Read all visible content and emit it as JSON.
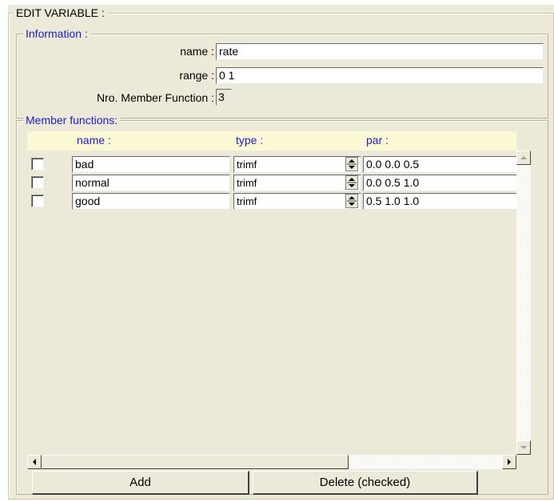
{
  "edit_variable": {
    "title": "EDIT VARIABLE :",
    "information": {
      "legend": "Information :",
      "name_label": "name :",
      "name_value": "rate",
      "range_label": "range :",
      "range_value": "0 1",
      "nro_label": "Nro. Member Function :",
      "nro_value": "3"
    },
    "member_functions": {
      "legend": "Member functions:",
      "columns": {
        "name": "name :",
        "type": "type :",
        "par": "par :"
      },
      "rows": [
        {
          "checked": false,
          "name": "bad",
          "type": "trimf",
          "par": "0.0 0.0 0.5"
        },
        {
          "checked": false,
          "name": "normal",
          "type": "trimf",
          "par": "0.0 0.5 1.0"
        },
        {
          "checked": false,
          "name": "good",
          "type": "trimf",
          "par": "0.5 1.0 1.0"
        }
      ]
    },
    "buttons": {
      "add": "Add",
      "delete": "Delete (checked)"
    }
  },
  "icons": [
    "checkbox",
    "spinner-icon",
    "scroll-up-icon",
    "scroll-down-icon",
    "scroll-left-icon",
    "scroll-right-icon"
  ]
}
